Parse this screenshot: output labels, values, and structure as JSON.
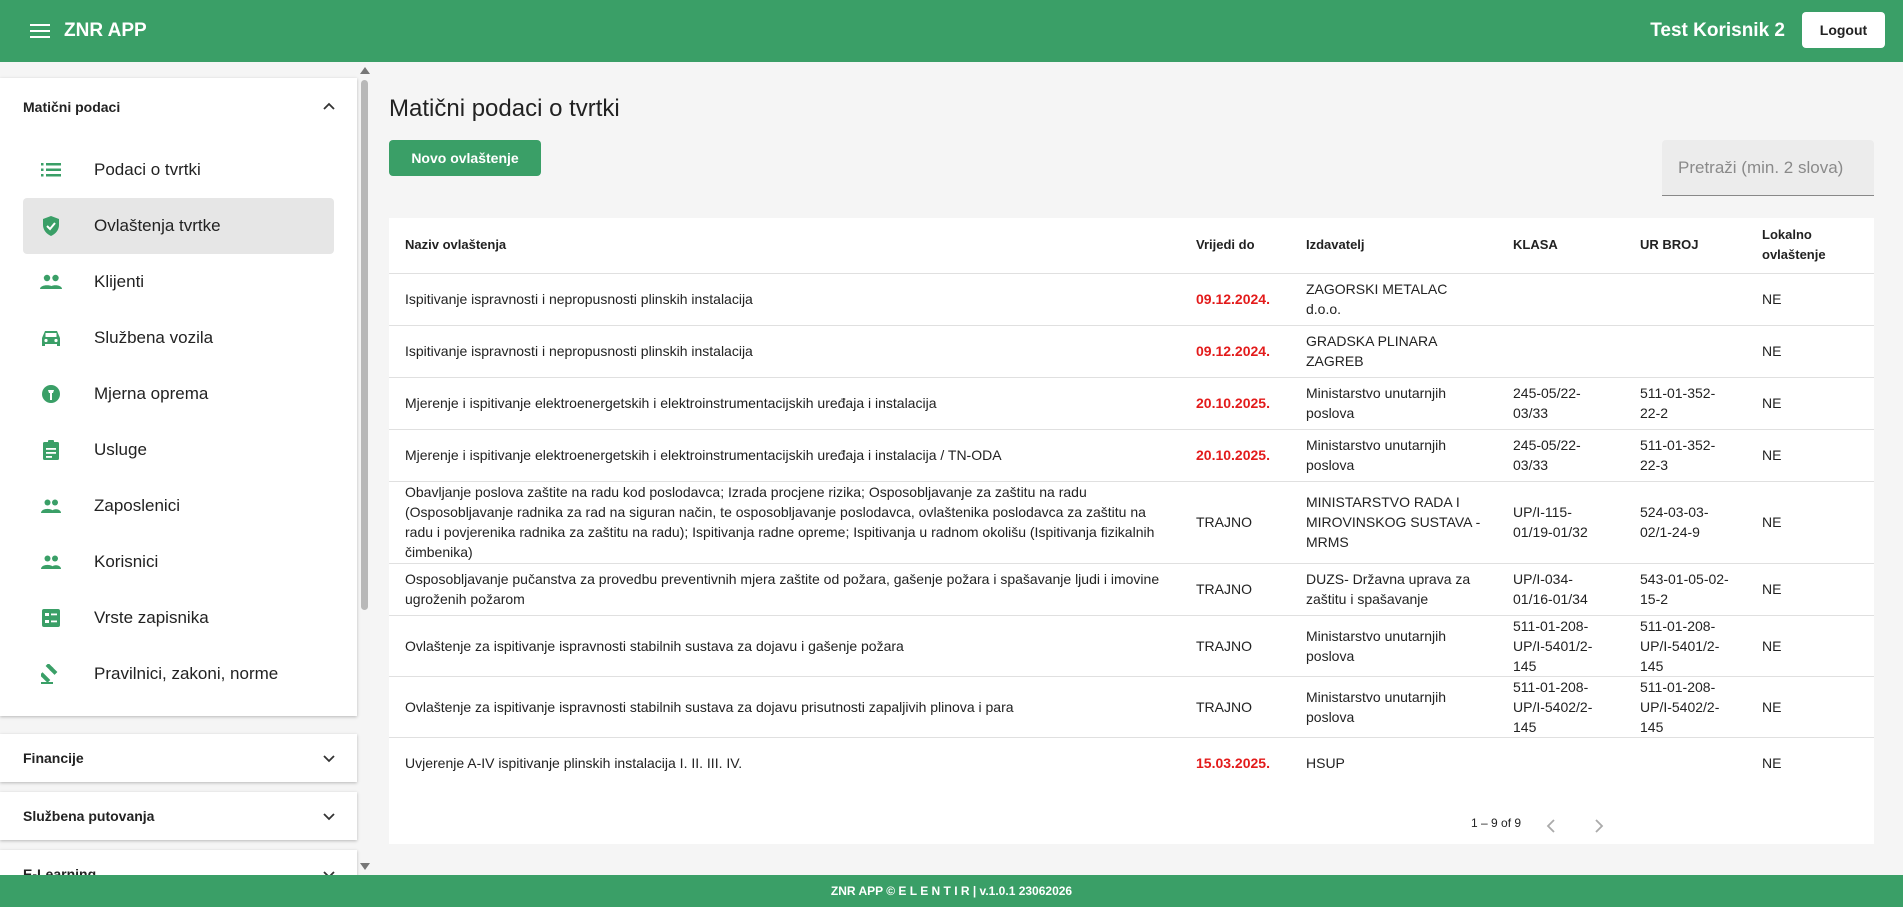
{
  "header": {
    "app_title": "ZNR APP",
    "user_name": "Test Korisnik 2",
    "logout_label": "Logout"
  },
  "sidebar": {
    "section_maticni": "Matični podaci",
    "items": [
      {
        "label": "Podaci o tvrtki",
        "icon": "list-icon"
      },
      {
        "label": "Ovlaštenja tvrtke",
        "icon": "shield-check-icon",
        "active": true
      },
      {
        "label": "Klijenti",
        "icon": "people-icon"
      },
      {
        "label": "Službena vozila",
        "icon": "car-icon"
      },
      {
        "label": "Mjerna oprema",
        "icon": "measuring-icon"
      },
      {
        "label": "Usluge",
        "icon": "clipboard-icon"
      },
      {
        "label": "Zaposlenici",
        "icon": "people-outline-icon"
      },
      {
        "label": "Korisnici",
        "icon": "people-outline-icon"
      },
      {
        "label": "Vrste zapisnika",
        "icon": "form-list-icon"
      },
      {
        "label": "Pravilnici, zakoni, norme",
        "icon": "gavel-icon"
      }
    ],
    "section_financije": "Financije",
    "section_putovanja": "Službena putovanja",
    "section_elearning": "E-Learning"
  },
  "main": {
    "title": "Matični podaci o tvrtki",
    "new_button": "Novo ovlaštenje",
    "search_placeholder": "Pretraži (min. 2 slova)"
  },
  "table": {
    "headers": {
      "naziv": "Naziv ovlaštenja",
      "vrijedi": "Vrijedi do",
      "izdavatelj": "Izdavatelj",
      "klasa": "KLASA",
      "urbroj": "UR BROJ",
      "lokalno": "Lokalno ovlaštenje"
    },
    "rows": [
      {
        "naziv": "Ispitivanje ispravnosti i nepropusnosti plinskih instalacija",
        "vrijedi": "09.12.2024.",
        "izdavatelj": "ZAGORSKI METALAC d.o.o.",
        "klasa": "",
        "urbroj": "",
        "lokalno": "NE"
      },
      {
        "naziv": "Ispitivanje ispravnosti i nepropusnosti plinskih instalacija",
        "vrijedi": "09.12.2024.",
        "izdavatelj": "GRADSKA PLINARA ZAGREB",
        "klasa": "",
        "urbroj": "",
        "lokalno": "NE"
      },
      {
        "naziv": "Mjerenje i ispitivanje elektroenergetskih i elektroinstrumentacijskih uređaja i instalacija",
        "vrijedi": "20.10.2025.",
        "izdavatelj": "Ministarstvo unutarnjih poslova",
        "klasa": "245-05/22-03/33",
        "urbroj": "511-01-352-22-2",
        "lokalno": "NE"
      },
      {
        "naziv": "Mjerenje i ispitivanje elektroenergetskih i elektroinstrumentacijskih uređaja i instalacija / TN-ODA",
        "vrijedi": "20.10.2025.",
        "izdavatelj": "Ministarstvo unutarnjih poslova",
        "klasa": "245-05/22-03/33",
        "urbroj": "511-01-352-22-3",
        "lokalno": "NE"
      },
      {
        "naziv": "Obavljanje poslova zaštite na radu kod poslodavca; Izrada procjene rizika; Osposobljavanje za zaštitu na radu (Osposobljavanje radnika za rad na siguran način, te osposobljavanje poslodavca, ovlaštenika poslodavca za zaštitu na radu i povjerenika radnika za zaštitu na radu); Ispitivanja radne opreme; Ispitivanja u radnom okolišu (Ispitivanja fizikalnih čimbenika)",
        "vrijedi": "TRAJNO",
        "izdavatelj": "MINISTARSTVO RADA I MIROVINSKOG SUSTAVA - MRMS",
        "klasa": "UP/I-115-01/19-01/32",
        "urbroj": "524-03-03-02/1-24-9",
        "lokalno": "NE"
      },
      {
        "naziv": "Osposobljavanje pučanstva za provedbu preventivnih mjera zaštite od požara, gašenje požara i spašavanje ljudi i imovine ugroženih požarom",
        "vrijedi": "TRAJNO",
        "izdavatelj": "DUZS- Državna uprava za zaštitu i spašavanje",
        "klasa": "UP/I-034-01/16-01/34",
        "urbroj": "543-01-05-02-15-2",
        "lokalno": "NE"
      },
      {
        "naziv": "Ovlaštenje za ispitivanje ispravnosti stabilnih sustava za dojavu i gašenje požara",
        "vrijedi": "TRAJNO",
        "izdavatelj": "Ministarstvo unutarnjih poslova",
        "klasa": "511-01-208-UP/I-5401/2-145",
        "urbroj": "511-01-208-UP/I-5401/2-145",
        "lokalno": "NE"
      },
      {
        "naziv": "Ovlaštenje za ispitivanje ispravnosti stabilnih sustava za dojavu prisutnosti zapaljivih plinova i para",
        "vrijedi": "TRAJNO",
        "izdavatelj": "Ministarstvo unutarnjih poslova",
        "klasa": "511-01-208-UP/I-5402/2-145",
        "urbroj": "511-01-208-UP/I-5402/2-145",
        "lokalno": "NE"
      },
      {
        "naziv": "Uvjerenje A-IV ispitivanje plinskih instalacija I. II. III. IV.",
        "vrijedi": "15.03.2025.",
        "izdavatelj": "HSUP",
        "klasa": "",
        "urbroj": "",
        "lokalno": "NE"
      }
    ],
    "paginator": "1 – 9 of 9"
  },
  "footer": {
    "text": "ZNR APP © E L E N T I R | v.1.0.1 23062026"
  },
  "colors": {
    "brand": "#3a9f67",
    "expired": "#e31b1b"
  }
}
